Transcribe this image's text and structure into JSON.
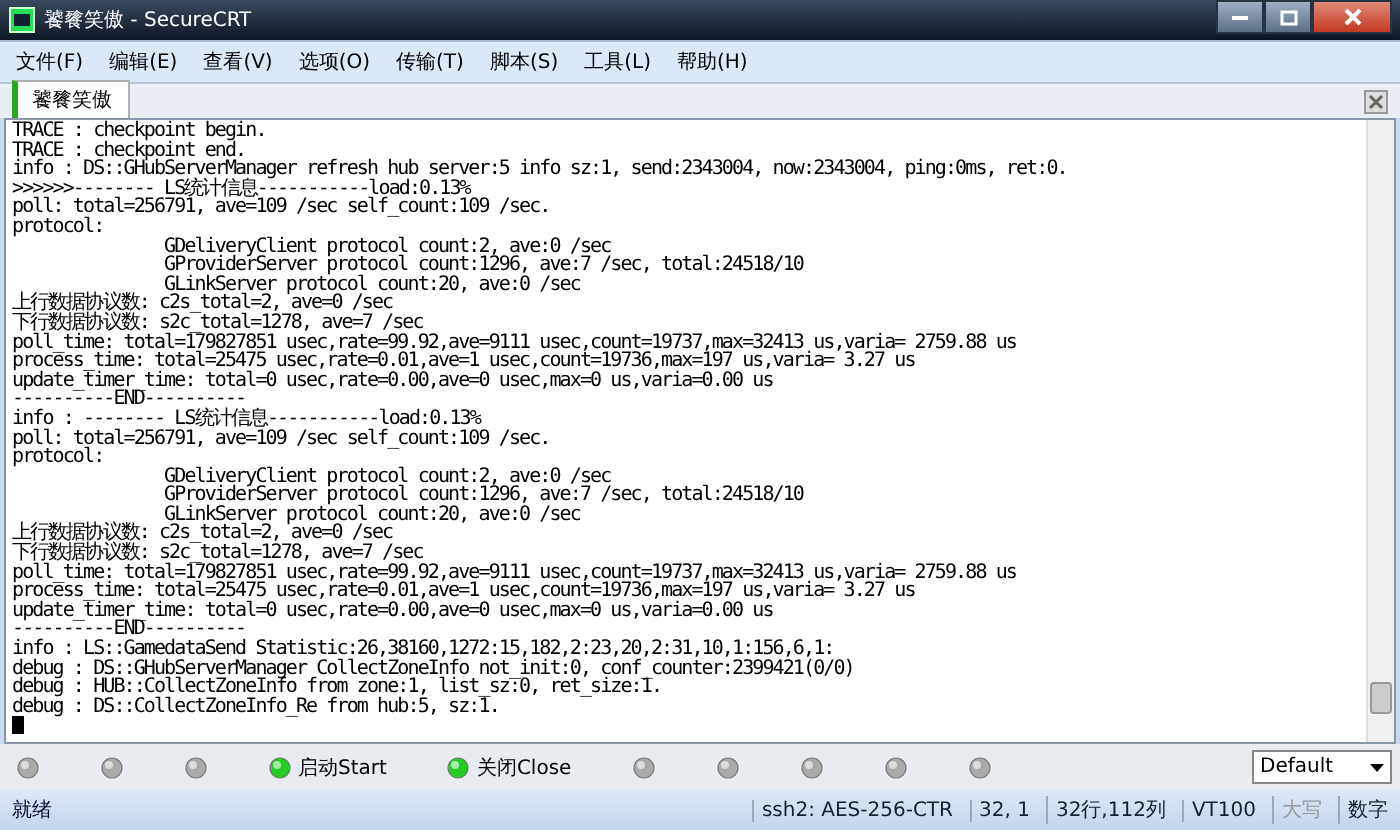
{
  "window": {
    "title": "饕餮笑傲 - SecureCRT"
  },
  "menu": [
    "文件(F)",
    "编辑(E)",
    "查看(V)",
    "选项(O)",
    "传输(T)",
    "脚本(S)",
    "工具(L)",
    "帮助(H)"
  ],
  "tabs": [
    {
      "label": "饕餮笑傲",
      "selected": true
    }
  ],
  "terminal": {
    "lines": [
      "TRACE : checkpoint begin.",
      "TRACE : checkpoint end.",
      "info : DS::GHubServerManager refresh hub server:5 info sz:1, send:2343004, now:2343004, ping:0ms, ret:0.",
      ">>>>>>-------- LS统计信息-----------load:0.13%",
      "poll: total=256791, ave=109 /sec self_count:109 /sec.",
      "protocol:",
      "               GDeliveryClient protocol count:2, ave:0 /sec",
      "               GProviderServer protocol count:1296, ave:7 /sec, total:24518/10",
      "               GLinkServer protocol count:20, ave:0 /sec",
      "上行数据协议数: c2s_total=2, ave=0 /sec",
      "下行数据协议数: s2c_total=1278, ave=7 /sec",
      "poll_time: total=179827851 usec,rate=99.92,ave=9111 usec,count=19737,max=32413 us,varia= 2759.88 us",
      "process_time: total=25475 usec,rate=0.01,ave=1 usec,count=19736,max=197 us,varia= 3.27 us",
      "update_timer_time: total=0 usec,rate=0.00,ave=0 usec,max=0 us,varia=0.00 us",
      "----------END----------",
      "info : -------- LS统计信息-----------load:0.13%",
      "poll: total=256791, ave=109 /sec self_count:109 /sec.",
      "protocol:",
      "               GDeliveryClient protocol count:2, ave:0 /sec",
      "               GProviderServer protocol count:1296, ave:7 /sec, total:24518/10",
      "               GLinkServer protocol count:20, ave:0 /sec",
      "上行数据协议数: c2s_total=2, ave=0 /sec",
      "下行数据协议数: s2c_total=1278, ave=7 /sec",
      "poll_time: total=179827851 usec,rate=99.92,ave=9111 usec,count=19737,max=32413 us,varia= 2759.88 us",
      "process_time: total=25475 usec,rate=0.01,ave=1 usec,count=19736,max=197 us,varia= 3.27 us",
      "update_timer_time: total=0 usec,rate=0.00,ave=0 usec,max=0 us,varia=0.00 us",
      "----------END----------",
      "info : LS::GamedataSend Statistic:26,38160,1272:15,182,2:23,20,2:31,10,1:156,6,1:",
      "debug : DS::GHubServerManager CollectZoneInfo not_init:0, conf_counter:2399421(0/0)",
      "debug : HUB::CollectZoneInfo from zone:1, list_sz:0, ret_size:1.",
      "debug : DS::CollectZoneInfo_Re from hub:5, sz:1."
    ]
  },
  "button_bar": [
    {
      "on": false
    },
    {
      "on": false
    },
    {
      "on": false
    },
    {
      "label": "启动Start",
      "on": true
    },
    {
      "label": "关闭Close",
      "on": true
    },
    {
      "on": false
    },
    {
      "on": false
    },
    {
      "on": false
    },
    {
      "on": false
    },
    {
      "on": false
    }
  ],
  "session_select": {
    "value": "Default"
  },
  "status_bar": {
    "message": "就绪",
    "fields": [
      {
        "text": "ssh2: AES-256-CTR",
        "disabled": false
      },
      {
        "text": "32,   1",
        "disabled": false
      },
      {
        "text": "32行,112列",
        "disabled": false
      },
      {
        "text": "VT100",
        "disabled": false
      },
      {
        "text": "大写",
        "disabled": true
      },
      {
        "text": "数字",
        "disabled": false
      }
    ]
  }
}
